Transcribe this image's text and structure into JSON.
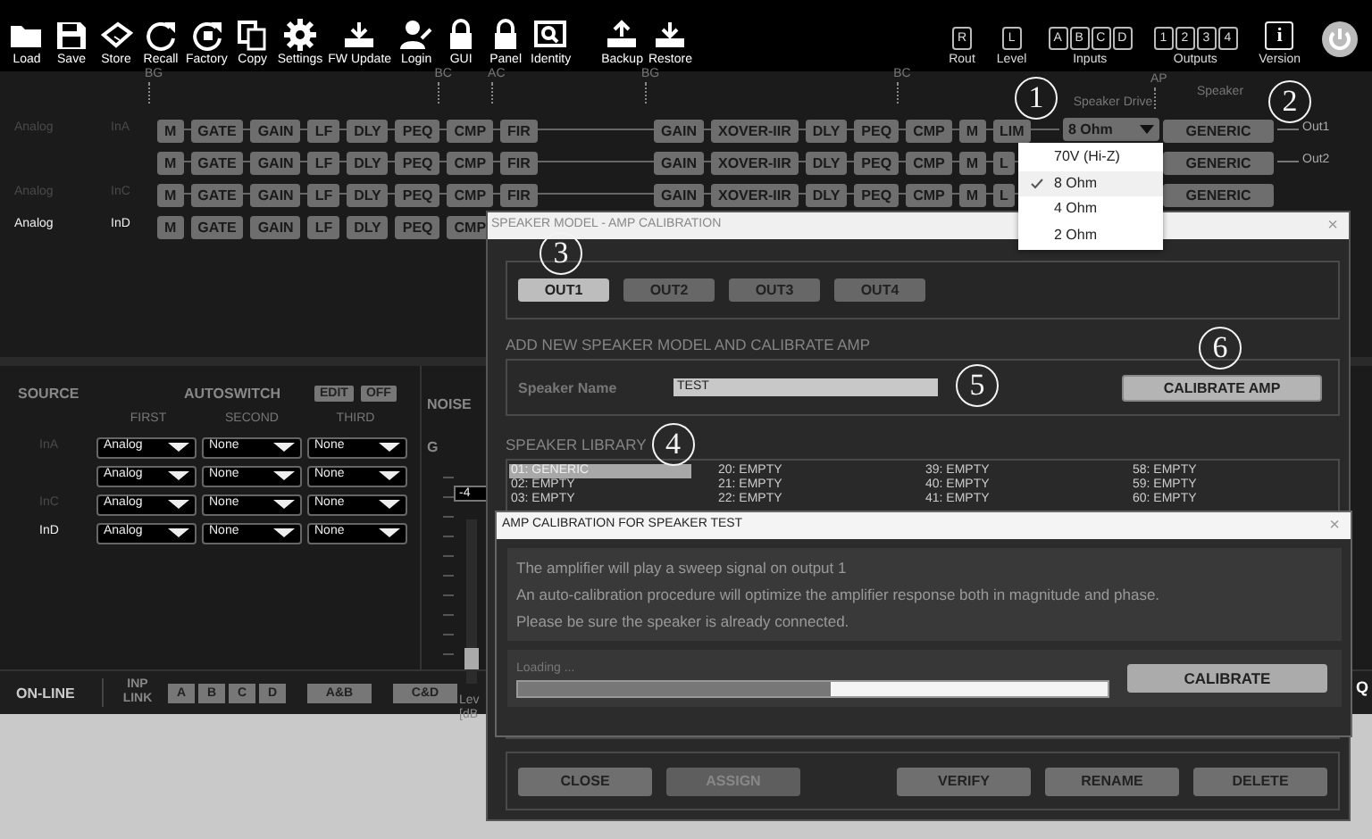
{
  "toolbar": {
    "items": [
      {
        "label": "Load"
      },
      {
        "label": "Save"
      },
      {
        "label": "Store"
      },
      {
        "label": "Recall"
      },
      {
        "label": "Factory"
      },
      {
        "label": "Copy"
      },
      {
        "label": "Settings"
      },
      {
        "label": "FW Update"
      },
      {
        "label": "Login"
      },
      {
        "label": "GUI"
      },
      {
        "label": "Panel"
      },
      {
        "label": "Identity"
      },
      {
        "label": "Backup"
      },
      {
        "label": "Restore"
      }
    ],
    "indicators": [
      {
        "keys": [
          "R"
        ],
        "label": "Rout"
      },
      {
        "keys": [
          "L"
        ],
        "label": "Level"
      },
      {
        "keys": [
          "A",
          "B",
          "C",
          "D"
        ],
        "label": "Inputs"
      },
      {
        "keys": [
          "1",
          "2",
          "3",
          "4"
        ],
        "label": "Outputs"
      },
      {
        "keys": [
          "i"
        ],
        "label": "Version"
      }
    ]
  },
  "chain": {
    "rows": [
      {
        "source": "Analog",
        "input": "InA",
        "active": false,
        "pre": [
          {
            "label": "M",
            "tag": "BG"
          },
          {
            "label": "GATE"
          },
          {
            "label": "GAIN"
          },
          {
            "label": "LF"
          },
          {
            "label": "DLY"
          },
          {
            "label": "PEQ"
          },
          {
            "label": "CMP",
            "tag": "BC"
          },
          {
            "label": "FIR",
            "tag": "AC"
          }
        ],
        "post": [
          {
            "label": "GAIN",
            "tag": "BG"
          },
          {
            "label": "XOVER-IIR"
          },
          {
            "label": "DLY"
          },
          {
            "label": "PEQ"
          },
          {
            "label": "CMP",
            "tag": "BC"
          },
          {
            "label": "M"
          },
          {
            "label": "LIM"
          }
        ],
        "drive": {
          "caption": "Speaker Drive",
          "value": "8 Ohm",
          "annotation": "1"
        },
        "speaker": {
          "caption": "Speaker",
          "tag": "AP",
          "label": "GENERIC",
          "annotation": "2"
        },
        "output": "Out1"
      },
      {
        "pre": [
          {
            "label": "M"
          },
          {
            "label": "GATE"
          },
          {
            "label": "GAIN"
          },
          {
            "label": "LF"
          },
          {
            "label": "DLY"
          },
          {
            "label": "PEQ"
          },
          {
            "label": "CMP"
          },
          {
            "label": "FIR"
          }
        ],
        "post": [
          {
            "label": "GAIN"
          },
          {
            "label": "XOVER-IIR"
          },
          {
            "label": "DLY"
          },
          {
            "label": "PEQ"
          },
          {
            "label": "CMP"
          },
          {
            "label": "M"
          },
          {
            "label": "L"
          }
        ],
        "speaker": {
          "label": "GENERIC"
        },
        "output": "Out2"
      },
      {
        "source": "Analog",
        "input": "InC",
        "active": false,
        "pre": [
          {
            "label": "M"
          },
          {
            "label": "GATE"
          },
          {
            "label": "GAIN"
          },
          {
            "label": "LF"
          },
          {
            "label": "DLY"
          },
          {
            "label": "PEQ"
          },
          {
            "label": "CMP"
          },
          {
            "label": "FIR"
          }
        ],
        "post": [
          {
            "label": "GAIN"
          },
          {
            "label": "XOVER-IIR"
          },
          {
            "label": "DLY"
          },
          {
            "label": "PEQ"
          },
          {
            "label": "CMP"
          },
          {
            "label": "M"
          },
          {
            "label": "L"
          }
        ],
        "speaker": {
          "label": "GENERIC"
        }
      },
      {
        "source": "Analog",
        "input": "InD",
        "active": true,
        "pre": [
          {
            "label": "M"
          },
          {
            "label": "GATE"
          },
          {
            "label": "GAIN"
          },
          {
            "label": "LF"
          },
          {
            "label": "DLY"
          },
          {
            "label": "PEQ"
          },
          {
            "label": "CMP"
          }
        ],
        "post": []
      }
    ],
    "drive_menu": {
      "options": [
        {
          "label": "70V (Hi-Z)",
          "selected": false
        },
        {
          "label": "8 Ohm",
          "selected": true
        },
        {
          "label": "4 Ohm",
          "selected": false
        },
        {
          "label": "2 Ohm",
          "selected": false
        }
      ]
    }
  },
  "source_panel": {
    "title": "SOURCE",
    "autoswitch": "AUTOSWITCH",
    "edit": "EDIT",
    "off": "OFF",
    "columns": [
      "FIRST",
      "SECOND",
      "THIRD"
    ],
    "rows": [
      {
        "input": "InA",
        "active": false,
        "choices": [
          "Analog",
          "None",
          "None"
        ]
      },
      {
        "choices": [
          "Analog",
          "None",
          "None"
        ]
      },
      {
        "input": "InC",
        "active": false,
        "choices": [
          "Analog",
          "None",
          "None"
        ]
      },
      {
        "input": "InD",
        "active": true,
        "choices": [
          "Analog",
          "None",
          "None"
        ]
      }
    ]
  },
  "noise_gate": {
    "title": "NOISE G",
    "value": "-4",
    "level": 0.1,
    "caption": [
      "Lev",
      "[dB"
    ]
  },
  "bottom_bar": {
    "status": "ON-LINE",
    "link_label": "INP LINK",
    "links": [
      "A",
      "B",
      "C",
      "D",
      "A&B",
      "C&D"
    ],
    "trailing": "Q"
  },
  "speaker_dialog": {
    "title": "SPEAKER MODEL - AMP CALIBRATION",
    "close": "×",
    "tabs": [
      {
        "label": "OUT1",
        "selected": true,
        "annotation": "3"
      },
      {
        "label": "OUT2",
        "selected": false
      },
      {
        "label": "OUT3",
        "selected": false
      },
      {
        "label": "OUT4",
        "selected": false
      }
    ],
    "add_heading": "ADD NEW SPEAKER MODEL AND CALIBRATE AMP",
    "name_label": "Speaker Name",
    "name_value": "TEST",
    "name_annotation": "5",
    "calibrate": {
      "label": "CALIBRATE AMP",
      "annotation": "6"
    },
    "library_heading": "SPEAKER LIBRARY",
    "library_annotation": "4",
    "library_columns": [
      [
        {
          "label": "01: GENERIC",
          "selected": true
        },
        {
          "label": "02: EMPTY",
          "selected": false
        },
        {
          "label": "03: EMPTY",
          "selected": false
        }
      ],
      [
        {
          "label": "20: EMPTY",
          "selected": false
        },
        {
          "label": "21: EMPTY",
          "selected": false
        },
        {
          "label": "22: EMPTY",
          "selected": false
        }
      ],
      [
        {
          "label": "39: EMPTY",
          "selected": false
        },
        {
          "label": "40: EMPTY",
          "selected": false
        },
        {
          "label": "41: EMPTY",
          "selected": false
        }
      ],
      [
        {
          "label": "58: EMPTY",
          "selected": false
        },
        {
          "label": "59: EMPTY",
          "selected": false
        },
        {
          "label": "60: EMPTY",
          "selected": false
        }
      ]
    ],
    "buttons": [
      {
        "label": "CLOSE",
        "disabled": false
      },
      {
        "label": "ASSIGN",
        "disabled": true
      },
      {
        "label": "VERIFY",
        "disabled": false
      },
      {
        "label": "RENAME",
        "disabled": false
      },
      {
        "label": "DELETE",
        "disabled": false
      }
    ]
  },
  "calibration_dialog": {
    "title": "AMP CALIBRATION FOR SPEAKER TEST",
    "close": "×",
    "message": [
      "The amplifier will play a sweep signal on output 1",
      "An auto-calibration procedure will optimize the amplifier response both in magnitude and phase.",
      "Please be sure the speaker is already connected."
    ],
    "status": "Loading ...",
    "level": 0.53,
    "button": "CALIBRATE"
  }
}
